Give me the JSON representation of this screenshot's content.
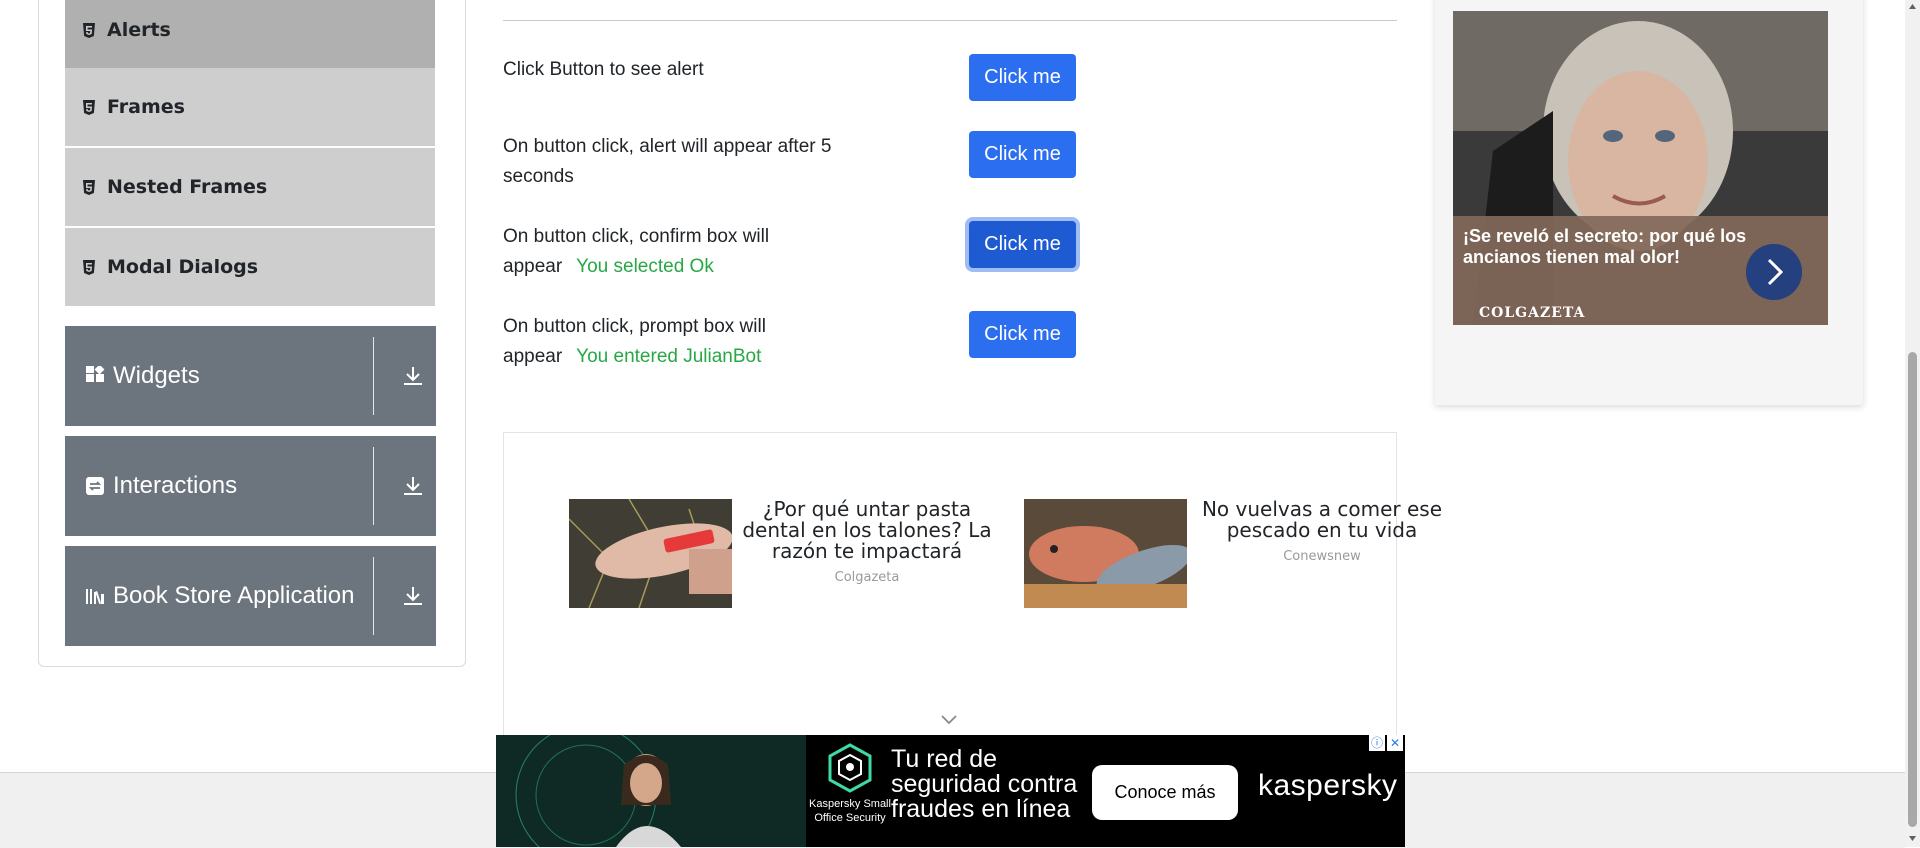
{
  "sidebar": {
    "sub_items": [
      {
        "label": "Alerts",
        "icon": "html5-icon",
        "active": true
      },
      {
        "label": "Frames",
        "icon": "html5-icon"
      },
      {
        "label": "Nested Frames",
        "icon": "html5-icon"
      },
      {
        "label": "Modal Dialogs",
        "icon": "html5-icon"
      }
    ],
    "groups": [
      {
        "label": "Widgets",
        "icon": "widgets-grid-icon"
      },
      {
        "label": "Interactions",
        "icon": "interactions-icon"
      },
      {
        "label": "Book Store Application",
        "icon": "bookshelf-icon"
      }
    ]
  },
  "alerts": {
    "rows": [
      {
        "label": "Click Button to see alert",
        "result": "",
        "button": "Click me"
      },
      {
        "label": "On button click, alert will appear after 5 seconds",
        "result": "",
        "button": "Click me"
      },
      {
        "label": "On button click, confirm box will appear",
        "result": "You selected Ok",
        "button": "Click me"
      },
      {
        "label": "On button click, prompt box will appear",
        "result": "You entered JulianBot",
        "button": "Click me"
      }
    ]
  },
  "native_ads": [
    {
      "headline": "¿Por qué untar pasta dental en los talones? La razón te impactará",
      "source": "Colgazeta"
    },
    {
      "headline": "No vuelvas a comer ese pescado en tu vida",
      "source": "Conewsnew"
    }
  ],
  "right_ad": {
    "caption": "¡Se reveló el secreto: por qué los ancianos tienen mal olor!",
    "source": "COLGAZETA"
  },
  "banner": {
    "product": "Kaspersky Small Office Security",
    "headline": "Tu red de seguridad contra fraudes en línea",
    "cta": "Conoce más",
    "brand": "kaspersky"
  },
  "colors": {
    "primary_button": "#2b6ef0",
    "result_text": "#28a745",
    "group_header": "#6c757d"
  }
}
